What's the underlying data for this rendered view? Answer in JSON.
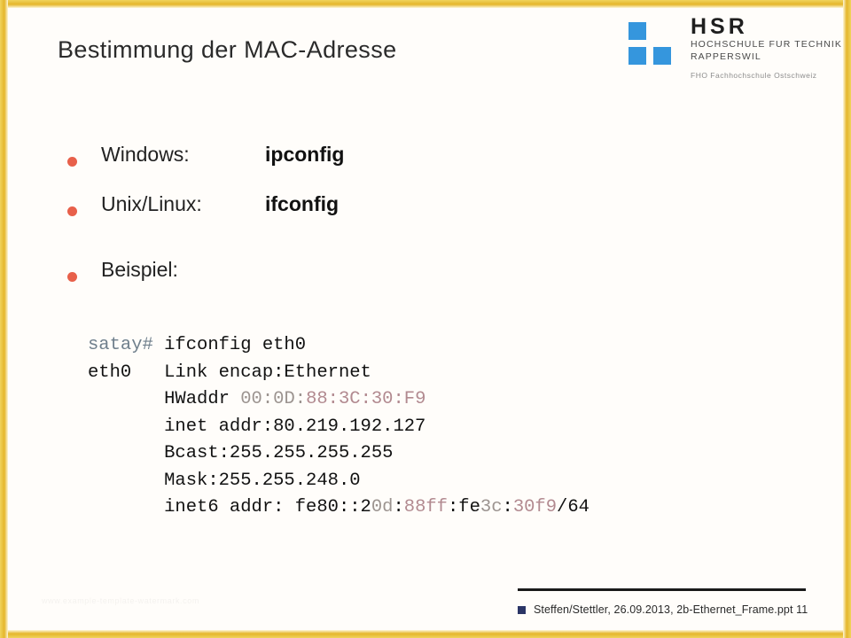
{
  "slide": {
    "title": "Bestimmung der MAC-Adresse",
    "accent_gold": "#e5b62b",
    "bullet_color": "#e8604a",
    "logo_blue": "#3596dd",
    "background": "#fffdfa"
  },
  "logo": {
    "brand": "HSR",
    "line1": "HOCHSCHULE FUR TECHNIK",
    "line2": "RAPPERSWIL",
    "line3": "FHO Fachhochschule Ostschweiz",
    "squares": [
      "square-top-left",
      "square-bottom-left",
      "square-bottom-right"
    ]
  },
  "bullets": [
    {
      "label": "Windows:",
      "command": "ipconfig"
    },
    {
      "label": "Unix/Linux:",
      "command": "ifconfig"
    },
    {
      "label": "Beispiel:",
      "command": ""
    }
  ],
  "terminal": {
    "lines": [
      {
        "id": "line-command",
        "segments": [
          {
            "text": "satay#",
            "style": "prompt"
          },
          {
            "text": " ifconfig eth0",
            "style": "normal"
          }
        ]
      },
      {
        "id": "line-eth0",
        "segments": [
          {
            "text": "eth0   Link encap:Ethernet",
            "style": "normal"
          }
        ]
      },
      {
        "id": "line-hwaddr",
        "segments": [
          {
            "text": "       HWaddr ",
            "style": "normal"
          },
          {
            "text": "00:0D",
            "style": "gray"
          },
          {
            "text": ":",
            "style": "gray"
          },
          {
            "text": "88:3C:30:F9",
            "style": "pink"
          }
        ]
      },
      {
        "id": "line-inet",
        "segments": [
          {
            "text": "       inet addr:80.219.192.127",
            "style": "normal"
          }
        ]
      },
      {
        "id": "line-bcast",
        "segments": [
          {
            "text": "       Bcast:255.255.255.255",
            "style": "normal"
          }
        ]
      },
      {
        "id": "line-mask",
        "segments": [
          {
            "text": "       Mask:255.255.248.0",
            "style": "normal"
          }
        ]
      },
      {
        "id": "line-inet6",
        "segments": [
          {
            "text": "       inet6 addr: fe80::2",
            "style": "normal"
          },
          {
            "text": "0d",
            "style": "gray"
          },
          {
            "text": ":",
            "style": "normal"
          },
          {
            "text": "88ff",
            "style": "pink"
          },
          {
            "text": ":fe",
            "style": "normal"
          },
          {
            "text": "3c",
            "style": "gray"
          },
          {
            "text": ":",
            "style": "normal"
          },
          {
            "text": "30f9",
            "style": "pink"
          },
          {
            "text": "/64",
            "style": "normal"
          }
        ]
      }
    ]
  },
  "footer": {
    "text": "Steffen/Stettler, 26.09.2013, 2b-Ethernet_Frame.ppt 11"
  },
  "watermark": {
    "text": "www.example-template-watermark.com"
  }
}
